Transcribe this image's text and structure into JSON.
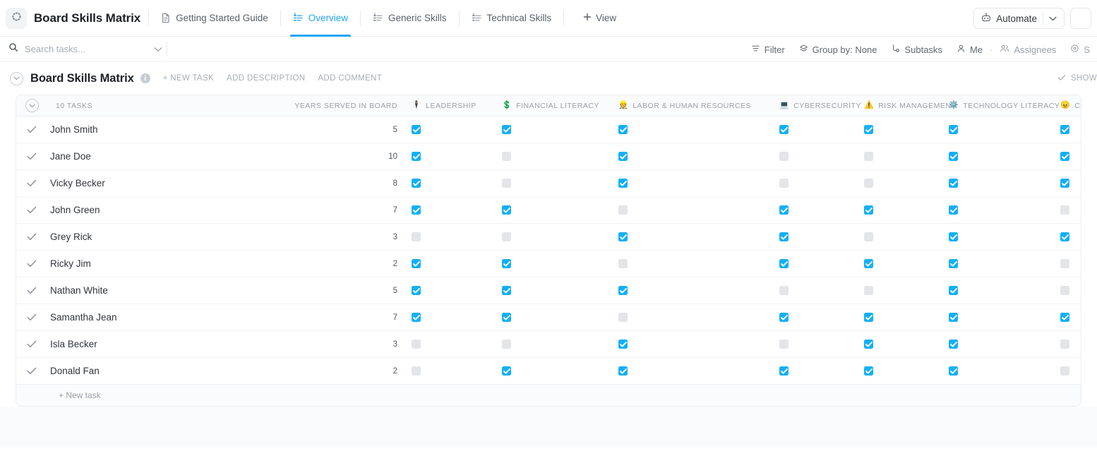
{
  "app": {
    "logo_icon": "dotted-circle-icon",
    "title": "Board Skills Matrix"
  },
  "tabs": [
    {
      "label": "Getting Started Guide",
      "icon": "doc-icon",
      "active": false
    },
    {
      "label": "Overview",
      "icon": "list-icon",
      "active": true
    },
    {
      "label": "Generic Skills",
      "icon": "list-icon",
      "active": false
    },
    {
      "label": "Technical Skills",
      "icon": "list-icon",
      "active": false
    }
  ],
  "add_view": {
    "label": "View",
    "icon": "plus-icon"
  },
  "automate": {
    "label": "Automate",
    "icon": "robot-icon",
    "caret": "chevron-down-icon"
  },
  "search": {
    "placeholder": "Search tasks...",
    "value": "",
    "icon": "search-icon",
    "caret": "chevron-down-icon"
  },
  "toolbar": [
    {
      "label": "Filter",
      "icon": "filter-icon",
      "muted": false
    },
    {
      "label": "Group by: None",
      "icon": "layers-icon",
      "muted": false
    },
    {
      "label": "Subtasks",
      "icon": "subtask-icon",
      "muted": false
    },
    {
      "label": "Me",
      "icon": "person-icon",
      "muted": false
    },
    {
      "label": "Assignees",
      "icon": "people-icon",
      "muted": true
    },
    {
      "label": "S",
      "icon": "eye-icon",
      "muted": true
    }
  ],
  "project": {
    "title": "Board Skills Matrix",
    "collapse_icon": "chevron-down-circle-icon",
    "info_icon": "info-icon",
    "actions": [
      "+ NEW TASK",
      "ADD DESCRIPTION",
      "ADD COMMENT"
    ],
    "show_closed": {
      "label": "SHOW",
      "icon": "check-icon"
    }
  },
  "table": {
    "task_count_label": "10 TASKS",
    "group_collapse_icon": "chevron-down-circle-icon",
    "years_column": "YEARS SERVED IN BOARD",
    "skill_columns": [
      {
        "label": "LEADERSHIP",
        "emoji": "🕴️",
        "icon": "person-suit-icon"
      },
      {
        "label": "FINANCIAL LITERACY",
        "emoji": "💲",
        "icon": "dollar-icon"
      },
      {
        "label": "LABOR & HUMAN RESOURCES",
        "emoji": "👷",
        "icon": "worker-icon"
      },
      {
        "label": "CYBERSECURITY",
        "emoji": "💻",
        "icon": "laptop-icon"
      },
      {
        "label": "RISK MANAGEMENT",
        "emoji": "⚠️",
        "icon": "warning-icon"
      },
      {
        "label": "TECHNOLOGY LITERACY",
        "emoji": "⚙️",
        "icon": "gear-icon"
      },
      {
        "label": "CONFLICT MANAGEMENT",
        "emoji": "😠",
        "icon": "angry-face-icon"
      }
    ],
    "rows": [
      {
        "name": "John Smith",
        "years": "5",
        "skills": [
          true,
          true,
          true,
          true,
          true,
          true,
          true
        ]
      },
      {
        "name": "Jane Doe",
        "years": "10",
        "skills": [
          true,
          false,
          true,
          false,
          false,
          true,
          true
        ]
      },
      {
        "name": "Vicky Becker",
        "years": "8",
        "skills": [
          true,
          false,
          true,
          false,
          false,
          true,
          true
        ]
      },
      {
        "name": "John Green",
        "years": "7",
        "skills": [
          true,
          true,
          false,
          true,
          true,
          true,
          false
        ]
      },
      {
        "name": "Grey Rick",
        "years": "3",
        "skills": [
          false,
          false,
          true,
          true,
          false,
          true,
          true
        ]
      },
      {
        "name": "Ricky Jim",
        "years": "2",
        "skills": [
          true,
          true,
          false,
          true,
          true,
          true,
          false
        ]
      },
      {
        "name": "Nathan White",
        "years": "5",
        "skills": [
          true,
          true,
          true,
          false,
          false,
          true,
          false
        ]
      },
      {
        "name": "Samantha Jean",
        "years": "7",
        "skills": [
          true,
          true,
          false,
          true,
          true,
          true,
          true
        ]
      },
      {
        "name": "Isla Becker",
        "years": "3",
        "skills": [
          false,
          false,
          true,
          false,
          true,
          true,
          false
        ]
      },
      {
        "name": "Donald Fan",
        "years": "2",
        "skills": [
          false,
          true,
          true,
          true,
          true,
          true,
          false
        ]
      }
    ],
    "row_check_icon": "check-icon",
    "new_task_label": "+ New task"
  },
  "colors": {
    "accent": "#1fa5f5",
    "checkbox_on": "#12b0f8",
    "checkbox_off": "#e3e5e8",
    "text_primary": "#1c1f24",
    "text_muted": "#9aa0a8",
    "panel_bg": "#fafbfc"
  }
}
